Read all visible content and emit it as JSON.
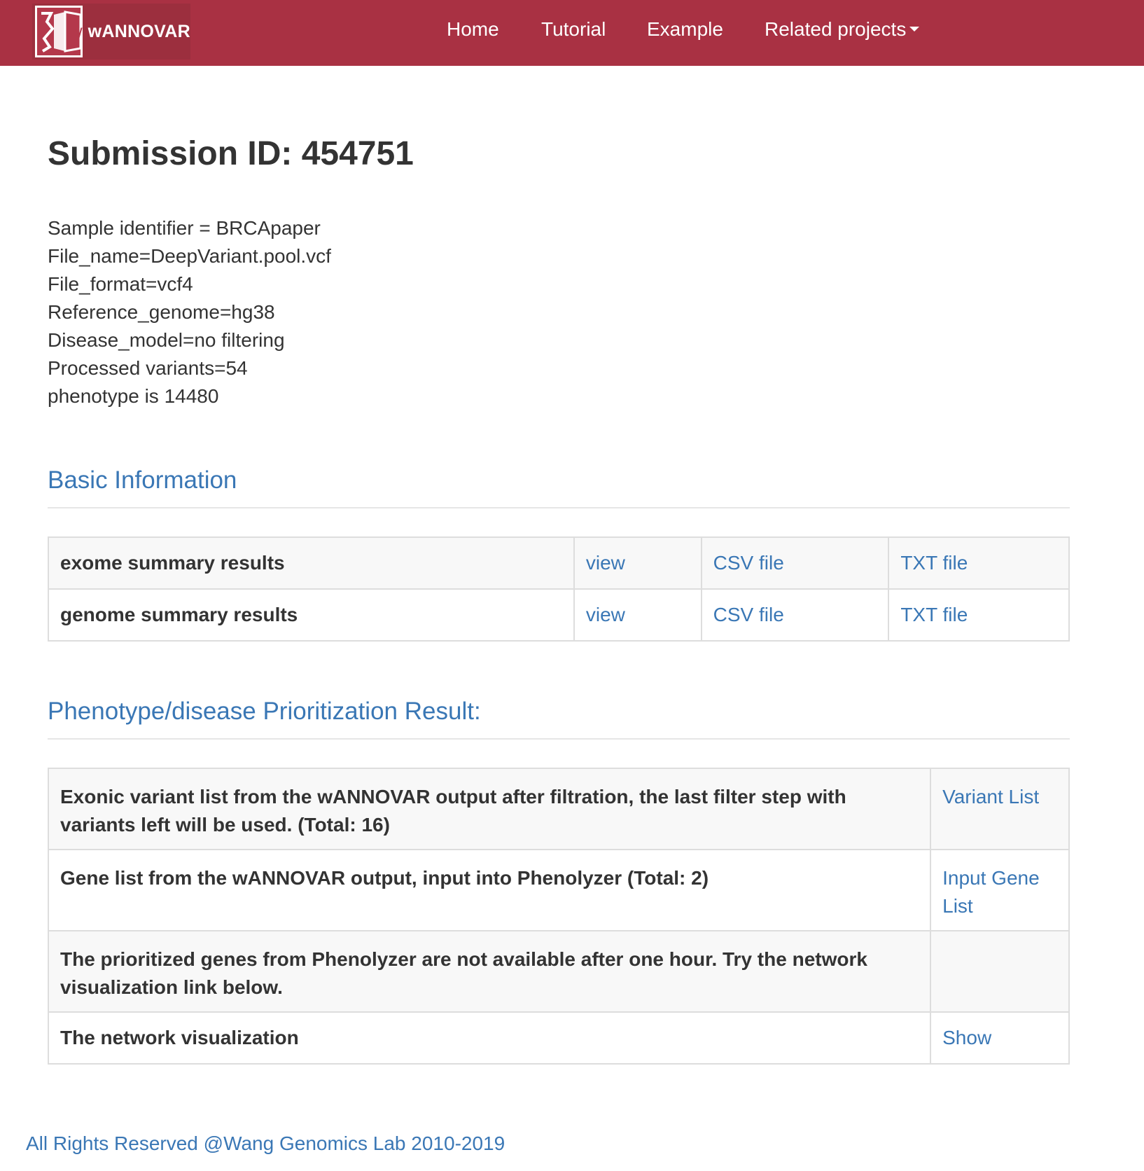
{
  "navbar": {
    "brand": "wANNOVAR",
    "logo_letter": "W",
    "links": [
      "Home",
      "Tutorial",
      "Example",
      "Related projects"
    ]
  },
  "title": "Submission ID: 454751",
  "info": [
    "Sample identifier = BRCApaper",
    "File_name=DeepVariant.pool.vcf",
    "File_format=vcf4",
    "Reference_genome=hg38",
    "Disease_model=no filtering",
    "Processed variants=54",
    "phenotype is 14480"
  ],
  "basic": {
    "heading": "Basic Information",
    "rows": [
      {
        "label": "exome summary results",
        "view": "view",
        "csv": "CSV file",
        "txt": "TXT file"
      },
      {
        "label": "genome summary results",
        "view": "view",
        "csv": "CSV file",
        "txt": "TXT file"
      }
    ]
  },
  "phenotype": {
    "heading": "Phenotype/disease Prioritization Result:",
    "rows": [
      {
        "label": "Exonic variant list from the wANNOVAR output after filtration, the last filter step with variants left will be used. (Total: 16)",
        "link": "Variant List"
      },
      {
        "label": "Gene list from the wANNOVAR output, input into Phenolyzer (Total: 2)",
        "link": "Input Gene List"
      },
      {
        "label": "The prioritized genes from Phenolyzer are not available after one hour. Try the network visualization link below.",
        "link": ""
      },
      {
        "label": "The network visualization",
        "link": "Show"
      }
    ]
  },
  "footer": "All Rights Reserved @Wang Genomics Lab 2010-2019",
  "colors": {
    "navbar": "#a93143",
    "link": "#3a77b5",
    "text": "#333333"
  }
}
